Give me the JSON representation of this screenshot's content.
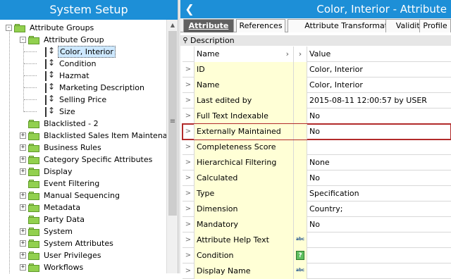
{
  "left_title": "System Setup",
  "tree": [
    {
      "label": "Attribute Groups",
      "type": "folder",
      "exp": "-",
      "selected": false
    },
    {
      "label": "Attribute Group",
      "type": "folder",
      "exp": "-",
      "selected": false
    },
    {
      "label": "Color, Interior",
      "type": "attribute",
      "exp": "",
      "selected": true
    },
    {
      "label": "Condition",
      "type": "attribute",
      "exp": "",
      "selected": false
    },
    {
      "label": "Hazmat",
      "type": "attribute",
      "exp": "",
      "selected": false
    },
    {
      "label": "Marketing Description",
      "type": "attribute",
      "exp": "",
      "selected": false
    },
    {
      "label": "Selling Price",
      "type": "attribute",
      "exp": "",
      "selected": false
    },
    {
      "label": "Size",
      "type": "attribute",
      "exp": "",
      "selected": false
    },
    {
      "label": "Blacklisted - 2",
      "type": "folder",
      "exp": "",
      "selected": false
    },
    {
      "label": "Blacklisted Sales Item Maintenance",
      "type": "folder",
      "exp": "+",
      "selected": false
    },
    {
      "label": "Business Rules",
      "type": "folder",
      "exp": "+",
      "selected": false
    },
    {
      "label": "Category Specific Attributes",
      "type": "folder",
      "exp": "+",
      "selected": false
    },
    {
      "label": "Display",
      "type": "folder",
      "exp": "+",
      "selected": false
    },
    {
      "label": "Event Filtering",
      "type": "folder",
      "exp": "",
      "selected": false
    },
    {
      "label": "Manual Sequencing",
      "type": "folder",
      "exp": "+",
      "selected": false
    },
    {
      "label": "Metadata",
      "type": "folder",
      "exp": "+",
      "selected": false
    },
    {
      "label": "Party Data",
      "type": "folder",
      "exp": "",
      "selected": false
    },
    {
      "label": "System",
      "type": "folder",
      "exp": "+",
      "selected": false
    },
    {
      "label": "System Attributes",
      "type": "folder",
      "exp": "+",
      "selected": false
    },
    {
      "label": "User Privileges",
      "type": "folder",
      "exp": "+",
      "selected": false
    },
    {
      "label": "Workflows",
      "type": "folder",
      "exp": "+",
      "selected": false
    }
  ],
  "right_title": "Color, Interior - Attribute",
  "tabs": [
    "Attribute",
    "References",
    "Attribute Transformation",
    "Validity",
    "Profile"
  ],
  "active_tab": "Attribute",
  "section_label": "Description",
  "grid_header": {
    "name": "Name",
    "value": "Value"
  },
  "rows": [
    {
      "name": "ID",
      "value": "Color, Interior",
      "icon": ""
    },
    {
      "name": "Name",
      "value": "Color, Interior",
      "icon": ""
    },
    {
      "name": "Last edited by",
      "value": "2015-08-11 12:00:57 by USER",
      "icon": ""
    },
    {
      "name": "Full Text Indexable",
      "value": "No",
      "icon": ""
    },
    {
      "name": "Externally Maintained",
      "value": "No",
      "icon": "",
      "highlight": true
    },
    {
      "name": "Completeness Score",
      "value": "",
      "icon": ""
    },
    {
      "name": "Hierarchical Filtering",
      "value": "None",
      "icon": ""
    },
    {
      "name": "Calculated",
      "value": "No",
      "icon": ""
    },
    {
      "name": "Type",
      "value": "Specification",
      "icon": ""
    },
    {
      "name": "Dimension Dependencies",
      "value": "Country;",
      "icon": ""
    },
    {
      "name": "Mandatory",
      "value": "No",
      "icon": ""
    },
    {
      "name": "Attribute Help Text",
      "value": "",
      "icon": "abc"
    },
    {
      "name": "Condition",
      "value": "",
      "icon": "?"
    },
    {
      "name": "Display Name",
      "value": "",
      "icon": "abc"
    }
  ],
  "icon_text": {
    "abc": "abc",
    "?": "?"
  }
}
